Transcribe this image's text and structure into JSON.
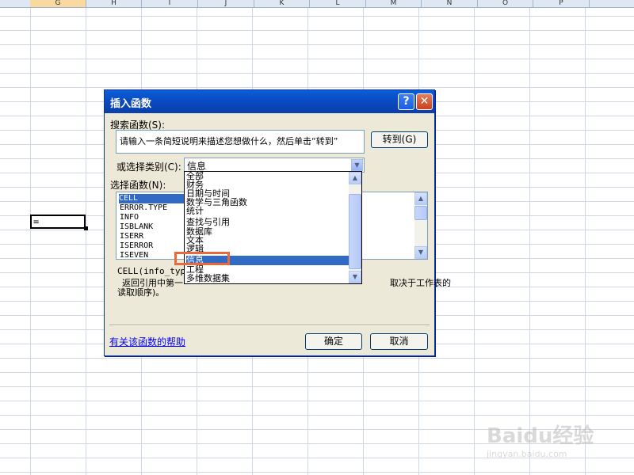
{
  "sheet": {
    "columns": [
      "G",
      "H",
      "I",
      "J",
      "K",
      "L",
      "M",
      "N",
      "O",
      "P"
    ],
    "active_column": "G",
    "active_cell_value": "="
  },
  "dialog": {
    "title": "插入函数",
    "help_button": "?",
    "close_button": "✕",
    "search_label": "搜索函数(S):",
    "search_value": "请输入一条简短说明来描述您想做什么，然后单击“转到”",
    "goto_button": "转到(G)",
    "category_label": "或选择类别(C):",
    "category_selected": "信息",
    "function_label": "选择函数(N):",
    "functions": [
      "CELL",
      "ERROR.TYPE",
      "INFO",
      "ISBLANK",
      "ISERR",
      "ISERROR",
      "ISEVEN"
    ],
    "selected_function": "CELL",
    "signature": "CELL(info_typ",
    "description_part1": "返回引用中第一",
    "description_part2": "取决于工作表的",
    "description_line2": "读取顺序)。",
    "help_link": "有关该函数的帮助",
    "ok_button": "确定",
    "cancel_button": "取消"
  },
  "category_dropdown": {
    "items": [
      "全部",
      "财务",
      "日期与时间",
      "数学与三角函数",
      "统计",
      "查找与引用",
      "数据库",
      "文本",
      "逻辑",
      "信息",
      "工程",
      "多维数据集"
    ],
    "selected": "信息"
  },
  "watermark": {
    "logo": "Baidu经验",
    "url": "jingyan.baidu.com"
  },
  "colors": {
    "title_bar": "#0a4bc2",
    "selection": "#316ac5",
    "highlight_box": "#e86a3a",
    "dialog_bg": "#ece9d8",
    "link": "#0000ff"
  },
  "icons": {
    "help": "question-icon",
    "close": "close-icon",
    "dropdown": "chevron-down-icon",
    "scroll_up": "chevron-up-icon",
    "scroll_down": "chevron-down-icon"
  }
}
